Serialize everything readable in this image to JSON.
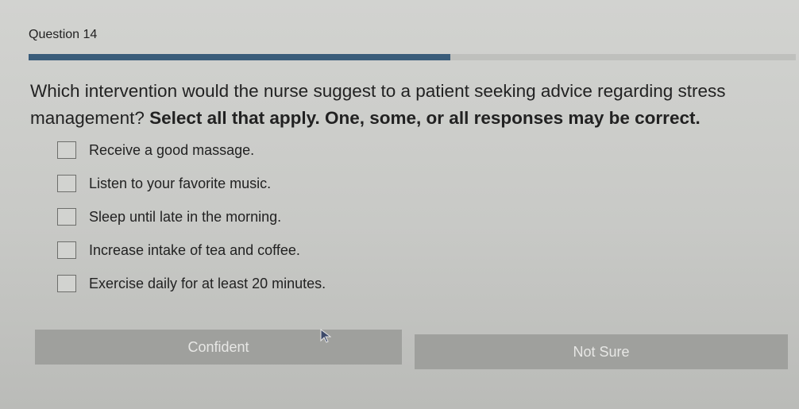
{
  "question": {
    "number_label": "Question 14",
    "progress_fraction": 0.55,
    "stem": "Which intervention would the nurse suggest to a patient seeking advice regarding stress management?",
    "instruction": "Select all that apply. One, some, or all responses may be correct."
  },
  "options": [
    {
      "label": "Receive a good massage.",
      "checked": false
    },
    {
      "label": "Listen to your favorite music.",
      "checked": false
    },
    {
      "label": "Sleep until late in the morning.",
      "checked": false
    },
    {
      "label": "Increase intake of tea and coffee.",
      "checked": false
    },
    {
      "label": "Exercise daily for at least 20 minutes.",
      "checked": false
    }
  ],
  "confidence": {
    "confident_label": "Confident",
    "not_sure_label": "Not Sure"
  },
  "colors": {
    "progress": "#3a5c7a",
    "button_bg": "#9fa09d",
    "button_text": "#e7e7e5"
  },
  "icons": {
    "cursor": "mouse-pointer-icon",
    "checkbox": "checkbox-icon"
  }
}
